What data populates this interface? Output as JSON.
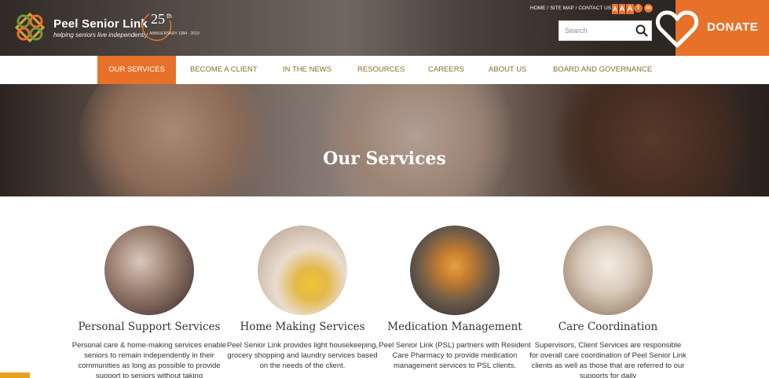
{
  "brand": {
    "name": "Peel Senior Link",
    "tagline": "helping seniors live independently",
    "anniversary": "25",
    "anniversary_suffix": "th",
    "anniversary_sub": "ANNIVERSARY 1994 - 2019"
  },
  "toplinks": [
    "HOME",
    "SITE MAP",
    "CONTACT US"
  ],
  "toplink_sep": "/",
  "text_size": [
    "A",
    "A",
    "A"
  ],
  "social": {
    "facebook": "f",
    "linkedin": "in"
  },
  "search": {
    "placeholder": "Search"
  },
  "donate": {
    "label": "DONATE"
  },
  "nav": [
    "OUR SERVICES",
    "BECOME A CLIENT",
    "IN THE NEWS",
    "RESOURCES",
    "CAREERS",
    "ABOUT US",
    "BOARD AND GOVERNANCE"
  ],
  "hero": {
    "title": "Our Services"
  },
  "services": [
    {
      "title": "Personal Support Services",
      "desc": "Personal care & home-making services enable seniors to remain independently in their communities as long as possible to provide support to seniors without taking"
    },
    {
      "title": "Home Making Services",
      "desc": "Peel Senior Link provides light housekeeping, grocery shopping and laundry services based on the needs of the client."
    },
    {
      "title": "Medication Management",
      "desc": "Peel Senior Link (PSL) partners with Resident Care Pharmacy to provide medication management services to PSL clients."
    },
    {
      "title": "Care Coordination",
      "desc": "Supervisors, Client Services are responsible for overall care coordination of Peel Senior Link clients as well as those that are referred to our supports for daily"
    }
  ],
  "colors": {
    "accent": "#e8712a",
    "nav_text": "#8a6a2a"
  }
}
